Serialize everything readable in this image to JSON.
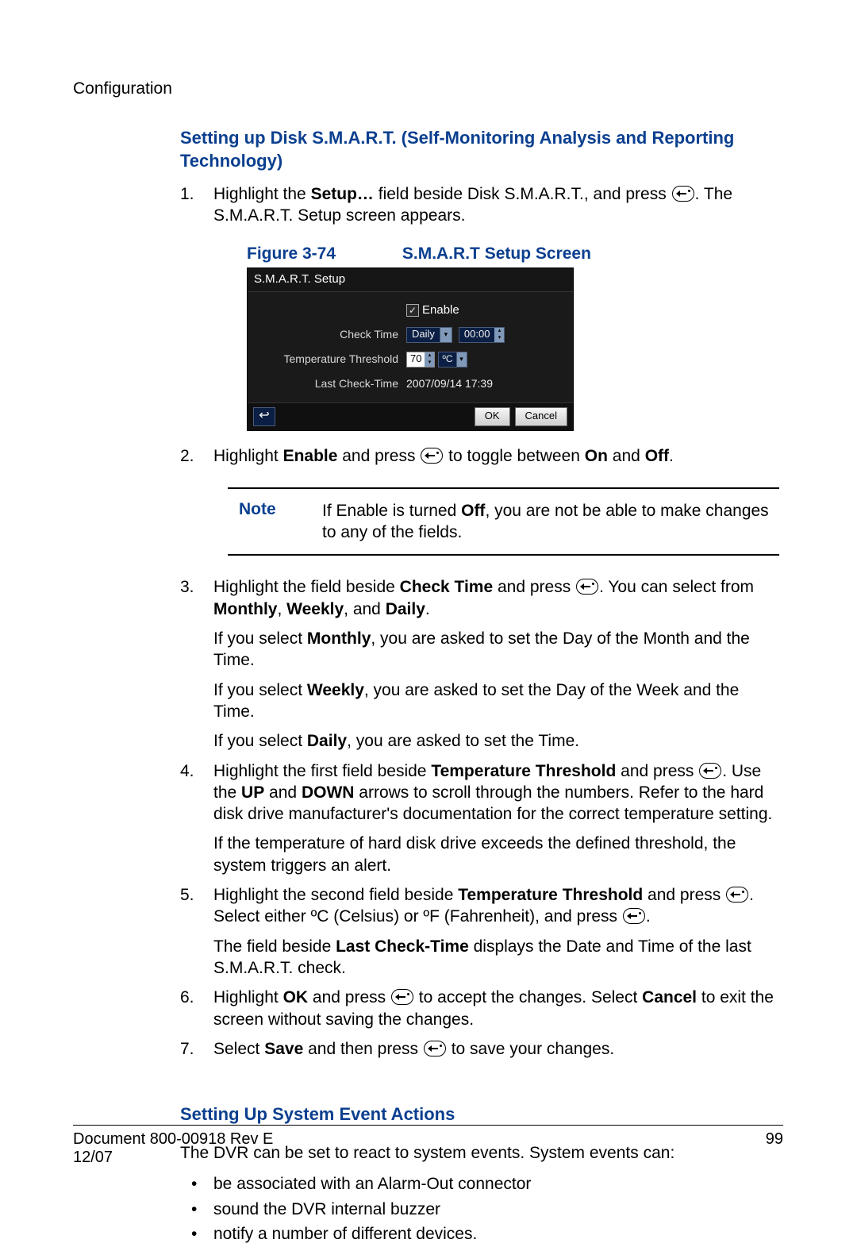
{
  "running_head": "Configuration",
  "heading1": "Setting up Disk S.M.A.R.T. (Self-Monitoring Analysis and Reporting Technology)",
  "steps": {
    "s1": {
      "num": "1.",
      "pre": "Highlight the ",
      "bold1": "Setup…",
      "mid": " field beside Disk S.M.A.R.T., and press ",
      "post": ". The S.M.A.R.T. Setup screen appears."
    },
    "fig": {
      "label": "Figure 3-74",
      "title": "S.M.A.R.T Setup Screen"
    },
    "s2": {
      "num": "2.",
      "pre": "Highlight ",
      "bold1": "Enable",
      "mid": " and press ",
      "post1": " to toggle between ",
      "bon": "On",
      "and": " and ",
      "boff": "Off",
      "end": "."
    },
    "s3": {
      "num": "3.",
      "pre": "Highlight the field beside ",
      "bold1": "Check Time",
      "mid": " and press ",
      "post": ". You can select from ",
      "bopts": "Monthly",
      "c1": ", ",
      "bopts2": "Weekly",
      "c2": ", and ",
      "bopts3": "Daily",
      "end": ".",
      "p1a": "If you select ",
      "p1b": "Monthly",
      "p1c": ", you are asked to set the Day of the Month and the Time.",
      "p2a": "If you select ",
      "p2b": "Weekly",
      "p2c": ", you are asked to set the Day of the Week and the Time.",
      "p3a": "If you select ",
      "p3b": "Daily",
      "p3c": ", you are asked to set the Time."
    },
    "s4": {
      "num": "4.",
      "pre": "Highlight the first field beside ",
      "bold1": "Temperature Threshold",
      "mid": " and press ",
      "post1": ". Use the ",
      "bup": "UP",
      "and": " and ",
      "bdown": "DOWN",
      "post2": " arrows to scroll through the numbers. Refer to the hard disk drive manufacturer's documentation for the correct temperature setting.",
      "p1": "If the temperature of hard disk drive exceeds the defined threshold, the system triggers an alert."
    },
    "s5": {
      "num": "5.",
      "pre": "Highlight the second field beside ",
      "bold1": "Temperature Threshold",
      "mid": " and press ",
      "post1": ". Select either ºC (Celsius) or ºF (Fahrenheit), and press ",
      "end": ".",
      "p1a": "The field beside ",
      "p1b": "Last Check-Time",
      "p1c": " displays the Date and Time of the last S.M.A.R.T. check."
    },
    "s6": {
      "num": "6.",
      "pre": "Highlight ",
      "bold1": "OK",
      "mid": " and press ",
      "post1": " to accept the changes. Select ",
      "bold2": "Cancel",
      "post2": " to exit the screen without saving the changes."
    },
    "s7": {
      "num": "7.",
      "pre": "Select ",
      "bold1": "Save",
      "mid": " and then press ",
      "post": " to save your changes."
    }
  },
  "note": {
    "label": "Note",
    "t1": "If Enable is turned ",
    "b1": "Off",
    "t2": ", you are not be able to make changes to any of the fields."
  },
  "heading2": "Setting Up System Event Actions",
  "intro2": "The DVR can be set to react to system events. System events can:",
  "bullets": [
    "be associated with an Alarm-Out connector",
    "sound the DVR internal buzzer",
    "notify a number of different devices."
  ],
  "shot": {
    "title": "S.M.A.R.T. Setup",
    "enable": "Enable",
    "check_time_lbl": "Check Time",
    "check_time_val": "Daily",
    "check_time_time": "00:00",
    "temp_lbl": "Temperature Threshold",
    "temp_val": "70",
    "temp_unit": "ºC",
    "last_lbl": "Last Check-Time",
    "last_val": "2007/09/14  17:39",
    "ok": "OK",
    "cancel": "Cancel"
  },
  "footer": {
    "doc": "Document 800-00918 Rev E",
    "date": "12/07",
    "page": "99"
  }
}
